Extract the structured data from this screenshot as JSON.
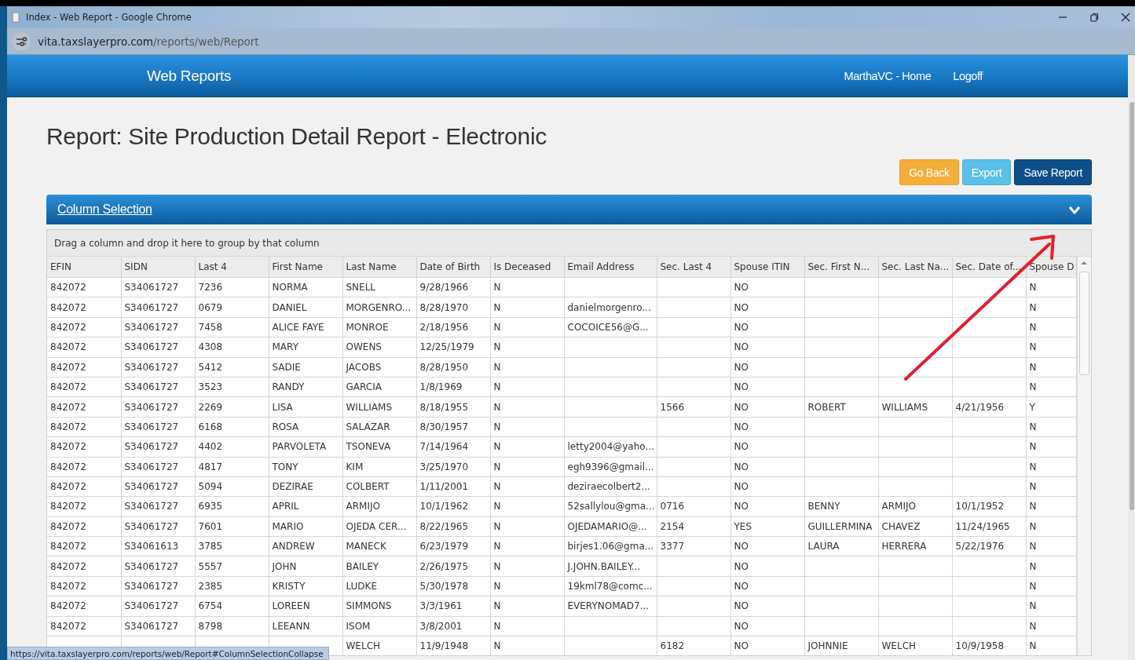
{
  "browser": {
    "title": "Index - Web Report - Google Chrome",
    "url_host": "vita.taxslayerpro.com",
    "url_path": "/reports/web/Report"
  },
  "nav": {
    "brand": "Web Reports",
    "links": [
      "MarthaVC - Home",
      "Logoff"
    ]
  },
  "title": "Report: Site Production Detail Report - Electronic",
  "buttons": [
    {
      "label": "Go Back",
      "kind": "warning"
    },
    {
      "label": "Export",
      "kind": "info"
    },
    {
      "label": "Save Report",
      "kind": "primary"
    }
  ],
  "panel": {
    "title": "Column Selection",
    "expanded": false
  },
  "grid": {
    "group_hint": "Drag a column and drop it here to group by that column",
    "columns": [
      "EFIN",
      "SIDN",
      "Last 4",
      "First Name",
      "Last Name",
      "Date of Birth",
      "Is Deceased",
      "Email Address",
      "Sec. Last 4",
      "Spouse ITIN",
      "Sec. First N...",
      "Sec. Last Na...",
      "Sec. Date of...",
      "Spouse D"
    ],
    "rows": [
      [
        "842072",
        "S34061727",
        "7236",
        "NORMA",
        "SNELL",
        "9/28/1966",
        "N",
        null,
        null,
        "NO",
        null,
        null,
        null,
        "N"
      ],
      [
        "842072",
        "S34061727",
        "0679",
        "DANIEL",
        "MORGENRO...",
        "8/28/1970",
        "N",
        "danielmorgenro...",
        null,
        "NO",
        null,
        null,
        null,
        "N"
      ],
      [
        "842072",
        "S34061727",
        "7458",
        "ALICE FAYE",
        "MONROE",
        "2/18/1956",
        "N",
        "COCOICE56@G...",
        null,
        "NO",
        null,
        null,
        null,
        "N"
      ],
      [
        "842072",
        "S34061727",
        "4308",
        "MARY",
        "OWENS",
        "12/25/1979",
        "N",
        null,
        null,
        "NO",
        null,
        null,
        null,
        "N"
      ],
      [
        "842072",
        "S34061727",
        "5412",
        "SADIE",
        "JACOBS",
        "8/28/1950",
        "N",
        null,
        null,
        "NO",
        null,
        null,
        null,
        "N"
      ],
      [
        "842072",
        "S34061727",
        "3523",
        "RANDY",
        "GARCIA",
        "1/8/1969",
        "N",
        null,
        null,
        "NO",
        null,
        null,
        null,
        "N"
      ],
      [
        "842072",
        "S34061727",
        "2269",
        "LISA",
        "WILLIAMS",
        "8/18/1955",
        "N",
        null,
        "1566",
        "NO",
        "ROBERT",
        "WILLIAMS",
        "4/21/1956",
        "Y"
      ],
      [
        "842072",
        "S34061727",
        "6168",
        "ROSA",
        "SALAZAR",
        "8/30/1957",
        "N",
        null,
        null,
        "NO",
        null,
        null,
        null,
        "N"
      ],
      [
        "842072",
        "S34061727",
        "4402",
        "PARVOLETA",
        "TSONEVA",
        "7/14/1964",
        "N",
        "letty2004@yaho...",
        null,
        "NO",
        null,
        null,
        null,
        "N"
      ],
      [
        "842072",
        "S34061727",
        "4817",
        "TONY",
        "KIM",
        "3/25/1970",
        "N",
        "egh9396@gmail...",
        null,
        "NO",
        null,
        null,
        null,
        "N"
      ],
      [
        "842072",
        "S34061727",
        "5094",
        "DEZIRAE",
        "COLBERT",
        "1/11/2001",
        "N",
        "deziraecolbert2...",
        null,
        "NO",
        null,
        null,
        null,
        "N"
      ],
      [
        "842072",
        "S34061727",
        "6935",
        "APRIL",
        "ARMIJO",
        "10/1/1962",
        "N",
        "52sallylou@gma...",
        "0716",
        "NO",
        "BENNY",
        "ARMIJO",
        "10/1/1952",
        "N"
      ],
      [
        "842072",
        "S34061727",
        "7601",
        "MARIO",
        "OJEDA CER...",
        "8/22/1965",
        "N",
        "OJEDAMARIO@...",
        "2154",
        "YES",
        "GUILLERMINA",
        "CHAVEZ",
        "11/24/1965",
        "N"
      ],
      [
        "842072",
        "S34061613",
        "3785",
        "ANDREW",
        "MANECK",
        "6/23/1979",
        "N",
        "birjes1.06@gma...",
        "3377",
        "NO",
        "LAURA",
        "HERRERA",
        "5/22/1976",
        "N"
      ],
      [
        "842072",
        "S34061727",
        "5557",
        "JOHN",
        "BAILEY",
        "2/26/1975",
        "N",
        "J.JOHN.BAILEY...",
        null,
        "NO",
        null,
        null,
        null,
        "N"
      ],
      [
        "842072",
        "S34061727",
        "2385",
        "KRISTY",
        "LUDKE",
        "5/30/1978",
        "N",
        "19kml78@comc...",
        null,
        "NO",
        null,
        null,
        null,
        "N"
      ],
      [
        "842072",
        "S34061727",
        "6754",
        "LOREEN",
        "SIMMONS",
        "3/3/1961",
        "N",
        "EVERYNOMAD7...",
        null,
        "NO",
        null,
        null,
        null,
        "N"
      ],
      [
        "842072",
        "S34061727",
        "8798",
        "LEEANN",
        "ISOM",
        "3/8/2001",
        "N",
        null,
        null,
        "NO",
        null,
        null,
        null,
        "N"
      ],
      [
        null,
        null,
        null,
        null,
        "WELCH",
        "11/9/1948",
        "N",
        null,
        "6182",
        "NO",
        "JOHNNIE",
        "WELCH",
        "10/9/1958",
        "N"
      ]
    ]
  },
  "status_url": "https://vita.taxslayerpro.com/reports/web/Report#ColumnSelectionCollapse"
}
